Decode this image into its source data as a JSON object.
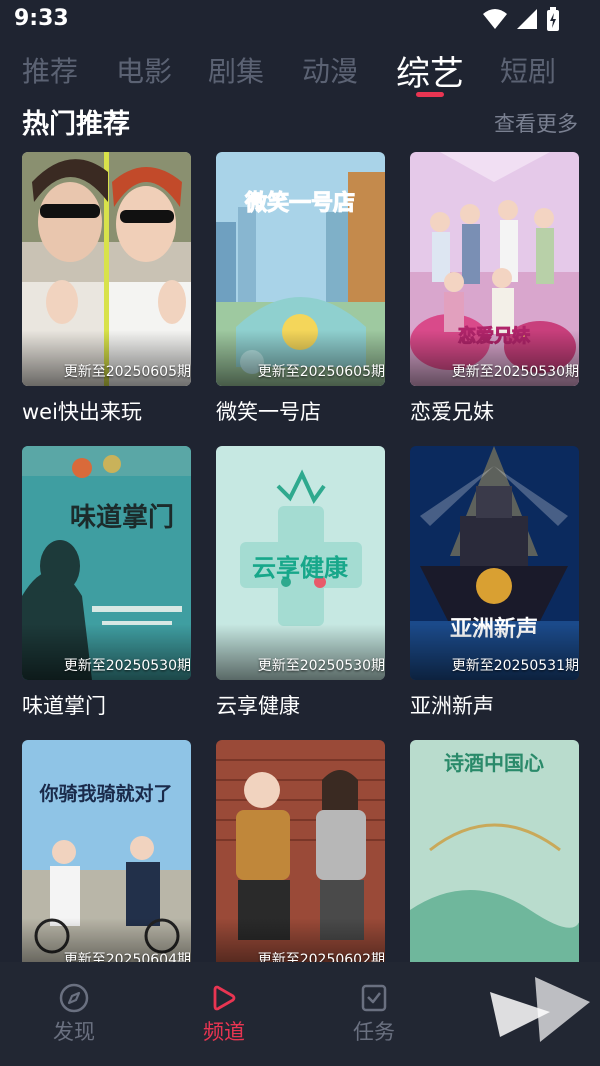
{
  "status": {
    "time": "9:33"
  },
  "tabs": [
    {
      "label": "推荐"
    },
    {
      "label": "电影"
    },
    {
      "label": "剧集"
    },
    {
      "label": "动漫"
    },
    {
      "label": "综艺"
    },
    {
      "label": "短剧"
    }
  ],
  "active_tab": "综艺",
  "section": {
    "title": "热门推荐",
    "more_label": "查看更多"
  },
  "cards": [
    {
      "title": "wei快出来玩",
      "update": "更新至20250605期"
    },
    {
      "title": "微笑一号店",
      "update": "更新至20250605期",
      "poster_text": "微笑一号店"
    },
    {
      "title": "恋爱兄妹",
      "update": "更新至20250530期",
      "poster_text": "恋爱兄妹"
    },
    {
      "title": "味道掌门",
      "update": "更新至20250530期",
      "poster_text": "味道掌门"
    },
    {
      "title": "云享健康",
      "update": "更新至20250530期",
      "poster_text": "云享健康"
    },
    {
      "title": "亚洲新声",
      "update": "更新至20250531期",
      "poster_text": "亚洲新声"
    },
    {
      "title": "",
      "update": "更新至20250604期",
      "poster_text": "你骑我骑就对了"
    },
    {
      "title": "",
      "update": "更新至20250602期"
    },
    {
      "title": "",
      "update": "",
      "poster_text": "诗酒中国心"
    }
  ],
  "nav": [
    {
      "label": "发现",
      "icon": "compass-icon"
    },
    {
      "label": "频道",
      "icon": "play-icon"
    },
    {
      "label": "任务",
      "icon": "task-check-icon"
    }
  ],
  "colors": {
    "accent": "#e93552",
    "background": "#1f2431",
    "inactive": "#5b6273"
  }
}
